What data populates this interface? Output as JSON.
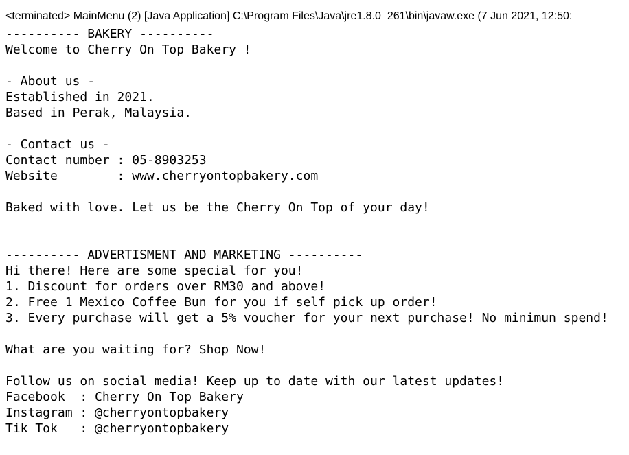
{
  "console": {
    "title": "<terminated> MainMenu (2) [Java Application] C:\\Program Files\\Java\\jre1.8.0_261\\bin\\javaw.exe (7 Jun 2021, 12:50:",
    "lines": [
      "---------- BAKERY ----------",
      "Welcome to Cherry On Top Bakery !",
      "",
      "- About us -",
      "Established in 2021.",
      "Based in Perak, Malaysia.",
      "",
      "- Contact us -",
      "Contact number : 05-8903253",
      "Website        : www.cherryontopbakery.com",
      "",
      "Baked with love. Let us be the Cherry On Top of your day!",
      "",
      "",
      "---------- ADVERTISMENT AND MARKETING ----------",
      "Hi there! Here are some special for you!",
      "1. Discount for orders over RM30 and above!",
      "2. Free 1 Mexico Coffee Bun for you if self pick up order!",
      "3. Every purchase will get a 5% voucher for your next purchase! No minimun spend!",
      "",
      "What are you waiting for? Shop Now!",
      "",
      "Follow us on social media! Keep up to date with our latest updates!",
      "Facebook  : Cherry On Top Bakery",
      "Instagram : @cherryontopbakery",
      "Tik Tok   : @cherryontopbakery"
    ]
  }
}
